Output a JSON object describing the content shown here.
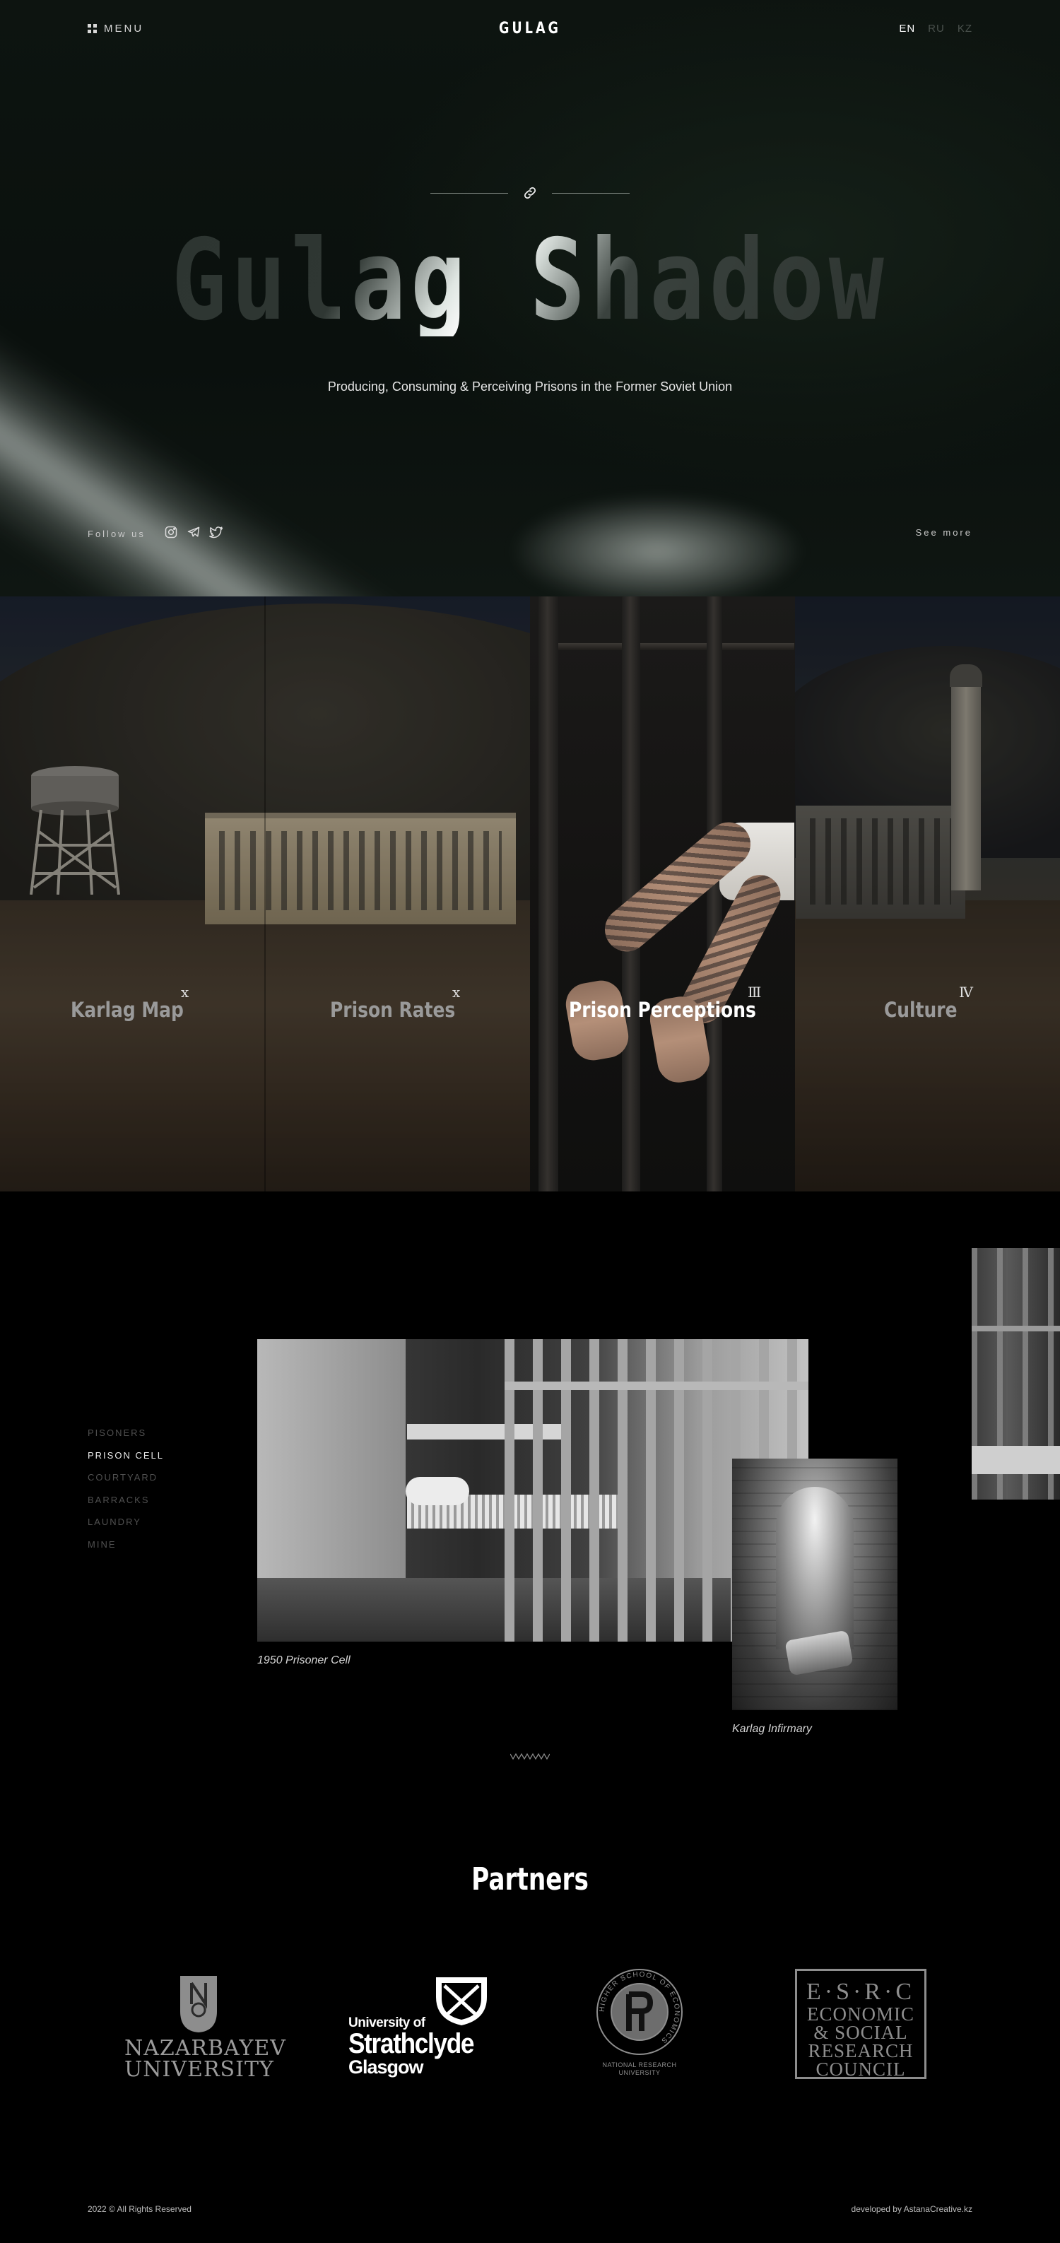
{
  "header": {
    "menu_label": "MENU",
    "logo": "GULAG",
    "languages": [
      {
        "code": "EN",
        "active": true
      },
      {
        "code": "RU",
        "active": false
      },
      {
        "code": "KZ",
        "active": false
      }
    ]
  },
  "hero": {
    "title": "Gulag Shadow",
    "subtitle": "Producing, Consuming & Perceiving Prisons in the Former Soviet Union",
    "follow_label": "Follow us",
    "social_icons": [
      "instagram-icon",
      "telegram-icon",
      "twitter-icon"
    ],
    "see_more": "See more"
  },
  "panels": [
    {
      "label": "Karlag Map",
      "numeral": "ⅹ",
      "active": false
    },
    {
      "label": "Prison Rates",
      "numeral": "ⅹ",
      "active": false
    },
    {
      "label": "Prison Perceptions",
      "numeral": "Ⅲ",
      "active": true
    },
    {
      "label": "Culture",
      "numeral": "Ⅳ",
      "active": false
    }
  ],
  "gallery": {
    "nav": [
      "PISONERS",
      "PRISON CELL",
      "COURTYARD",
      "BARRACKS",
      "LAUNDRY",
      "MINE"
    ],
    "active_index": 1,
    "photos": [
      {
        "caption": "1950 Prisoner Cell"
      },
      {
        "caption": "Karlag Infirmary"
      }
    ]
  },
  "partners": {
    "title": "Partners",
    "logos": [
      {
        "name": "NAZARBAYEV UNIVERSITY",
        "line1": "NAZARBAYEV",
        "line2": "UNIVERSITY"
      },
      {
        "name": "University of Strathclyde Glasgow",
        "line1": "University of",
        "line2": "Strathclyde",
        "line3": "Glasgow"
      },
      {
        "name": "Higher School of Economics",
        "ring_text": "HIGHER SCHOOL OF ECONOMICS",
        "caption1": "NATIONAL RESEARCH",
        "caption2": "UNIVERSITY"
      },
      {
        "name": "ESRC",
        "top": "E·S·R·C",
        "line1": "ECONOMIC",
        "line2": "& SOCIAL",
        "line3": "RESEARCH",
        "line4": "COUNCIL"
      }
    ]
  },
  "footer": {
    "copyright": "2022 © All Rights Reserved",
    "developer": "developed by AstanaCreative.kz"
  },
  "colors": {
    "background": "#000000",
    "hero_bg": "#0d1410",
    "text_primary": "#ffffff",
    "text_muted": "#505050",
    "logo_grey": "#8d8d8d"
  }
}
